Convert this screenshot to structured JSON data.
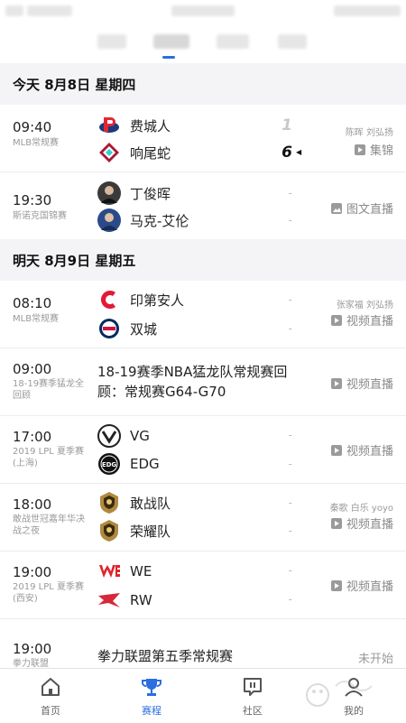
{
  "days": [
    {
      "header": "今天 8月8日 星期四",
      "matches": [
        {
          "time": "09:40",
          "league": "MLB常规赛",
          "teams": [
            {
              "name": "费城人",
              "logo": "phillies-logo",
              "score": "1"
            },
            {
              "name": "响尾蛇",
              "logo": "diamondbacks-logo",
              "score": "6"
            }
          ],
          "winner": 2,
          "commentators": "陈晖 刘弘扬",
          "broadcast": {
            "icon": "play-icon",
            "label": "集锦"
          }
        },
        {
          "time": "19:30",
          "league": "斯诺克国锦赛",
          "teams": [
            {
              "name": "丁俊晖",
              "logo": "player-photo",
              "score": "-"
            },
            {
              "name": "马克-艾伦",
              "logo": "player-photo",
              "score": "-"
            }
          ],
          "broadcast": {
            "icon": "image-icon",
            "label": "图文直播"
          }
        }
      ]
    },
    {
      "header": "明天 8月9日 星期五",
      "matches": [
        {
          "time": "08:10",
          "league": "MLB常规赛",
          "teams": [
            {
              "name": "印第安人",
              "logo": "indians-logo",
              "score": "-"
            },
            {
              "name": "双城",
              "logo": "twins-logo",
              "score": "-"
            }
          ],
          "commentators": "张家福 刘弘扬",
          "broadcast": {
            "icon": "play-icon",
            "label": "视频直播"
          }
        },
        {
          "time": "09:00",
          "league": "18-19赛季猛龙全回顾",
          "title": "18-19赛季NBA猛龙队常规赛回顾：常规赛G64-G70",
          "broadcast": {
            "icon": "play-icon",
            "label": "视频直播"
          }
        },
        {
          "time": "17:00",
          "league": "2019 LPL 夏季赛(上海)",
          "teams": [
            {
              "name": "VG",
              "logo": "vg-logo",
              "score": "-"
            },
            {
              "name": "EDG",
              "logo": "edg-logo",
              "score": "-"
            }
          ],
          "broadcast": {
            "icon": "play-icon",
            "label": "视频直播"
          }
        },
        {
          "time": "18:00",
          "league": "敢战世冠嘉年华决战之夜",
          "teams": [
            {
              "name": "敢战队",
              "logo": "gold-crest-logo",
              "score": "-"
            },
            {
              "name": "荣耀队",
              "logo": "gold-crest-logo",
              "score": "-"
            }
          ],
          "commentators": "秦歌 白乐 yoyo",
          "broadcast": {
            "icon": "play-icon",
            "label": "视频直播"
          }
        },
        {
          "time": "19:00",
          "league": "2019 LPL 夏季赛(西安)",
          "teams": [
            {
              "name": "WE",
              "logo": "we-logo",
              "score": "-"
            },
            {
              "name": "RW",
              "logo": "rw-logo",
              "score": "-"
            }
          ],
          "broadcast": {
            "icon": "play-icon",
            "label": "视频直播"
          }
        },
        {
          "time": "19:00",
          "league": "拳力联盟",
          "title": "拳力联盟第五季常规赛",
          "status": "未开始"
        }
      ]
    }
  ],
  "bottom_nav": [
    {
      "label": "首页",
      "icon": "home-icon",
      "active": false
    },
    {
      "label": "赛程",
      "icon": "trophy-icon",
      "active": true
    },
    {
      "label": "社区",
      "icon": "community-icon",
      "active": false
    },
    {
      "label": "我的",
      "icon": "profile-icon",
      "active": false
    }
  ],
  "colors": {
    "accent": "#2b6ee0",
    "day_header_bg": "#f4f4f6",
    "text": "#222222",
    "muted": "#9a9a9a"
  }
}
